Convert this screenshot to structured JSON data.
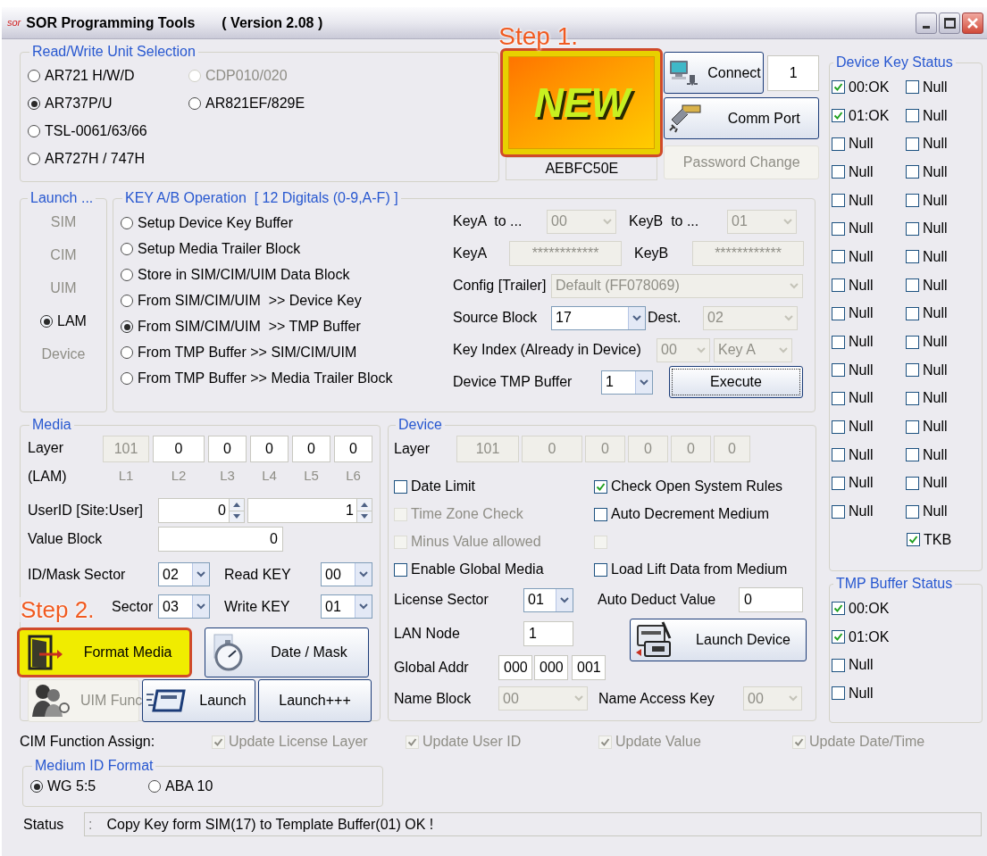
{
  "window": {
    "logo": "sor",
    "title": "SOR Programming Tools",
    "version": "( Version 2.08 )"
  },
  "unit_selection": {
    "title": "Read/Write Unit Selection",
    "rows": [
      [
        {
          "label": "AR721 H/W/D",
          "selected": false,
          "disabled": false
        },
        {
          "label": "CDP010/020",
          "selected": false,
          "disabled": true
        }
      ],
      [
        {
          "label": "AR737P/U",
          "selected": true,
          "disabled": false
        },
        {
          "label": "AR821EF/829E",
          "selected": false,
          "disabled": false
        }
      ],
      [
        {
          "label": "TSL-0061/63/66",
          "selected": false,
          "disabled": false
        }
      ],
      [
        {
          "label": "AR727H / 747H",
          "selected": false,
          "disabled": false
        }
      ]
    ]
  },
  "new_card": {
    "callout": "Step 1.",
    "label": "NEW",
    "highlighted": true,
    "serial": "AEBFC50E"
  },
  "connection": {
    "connect": {
      "label": "Connect",
      "disabled": false
    },
    "port": "1",
    "comm_port": {
      "label": "Comm Port",
      "disabled": false
    },
    "password": {
      "label": "Password Change",
      "disabled": true
    }
  },
  "launch": {
    "title": "Launch ...",
    "items": [
      {
        "label": "SIM",
        "selected": false,
        "disabled": true
      },
      {
        "label": "CIM",
        "selected": false,
        "disabled": true
      },
      {
        "label": "UIM",
        "selected": false,
        "disabled": true
      },
      {
        "label": "LAM",
        "selected": true,
        "disabled": false
      },
      {
        "label": "Device",
        "selected": false,
        "disabled": true
      }
    ]
  },
  "key_operation": {
    "title": "KEY A/B Operation  [ 12 Digitals (0-9,A-F) ]",
    "options": [
      {
        "label": "Setup Device Key Buffer",
        "selected": false
      },
      {
        "label": "Setup Media Trailer Block",
        "selected": false
      },
      {
        "label": "Store in SIM/CIM/UIM Data Block",
        "selected": false
      },
      {
        "label": "From SIM/CIM/UIM  >> Device Key",
        "selected": false
      },
      {
        "label": "From SIM/CIM/UIM  >> TMP Buffer",
        "selected": true
      },
      {
        "label": "From TMP Buffer >> SIM/CIM/UIM",
        "selected": false
      },
      {
        "label": "From TMP Buffer >> Media Trailer Block",
        "selected": false
      }
    ],
    "form": [
      [
        {
          "kind": "label",
          "text": "KeyA  to ..."
        },
        {
          "kind": "combo",
          "value": "00",
          "disabled": true
        },
        {
          "kind": "label",
          "text": "KeyB  to ..."
        },
        {
          "kind": "combo",
          "value": "01",
          "disabled": true
        }
      ],
      [
        {
          "kind": "label",
          "text": "KeyA"
        },
        {
          "kind": "field",
          "value": "************",
          "disabled": true
        },
        {
          "kind": "label",
          "text": "KeyB"
        },
        {
          "kind": "field",
          "value": "************",
          "disabled": true
        }
      ],
      [
        {
          "kind": "label",
          "text": "Config [Trailer]"
        },
        {
          "kind": "combo",
          "value": "Default (FF078069)",
          "disabled": true
        }
      ],
      [
        {
          "kind": "label",
          "text": "Source Block"
        },
        {
          "kind": "combo",
          "value": "17",
          "disabled": false
        },
        {
          "kind": "label",
          "text": "Dest."
        },
        {
          "kind": "combo",
          "value": "02",
          "disabled": true
        }
      ],
      [
        {
          "kind": "label",
          "text": "Key Index (Already in Device)"
        },
        {
          "kind": "combo",
          "value": "00",
          "disabled": true
        },
        {
          "kind": "combo",
          "value": "Key A",
          "disabled": true
        }
      ],
      [
        {
          "kind": "label",
          "text": "Device TMP Buffer"
        },
        {
          "kind": "combo",
          "value": "1",
          "disabled": false
        },
        {
          "kind": "button",
          "text": "Execute",
          "disabled": false
        }
      ]
    ]
  },
  "media": {
    "title": "Media",
    "layer_label": "Layer",
    "layer_sub": "(LAM)",
    "layers": [
      {
        "value": "101",
        "tag": "L1",
        "disabled": true
      },
      {
        "value": "0",
        "tag": "L2",
        "disabled": false
      },
      {
        "value": "0",
        "tag": "L3",
        "disabled": false
      },
      {
        "value": "0",
        "tag": "L4",
        "disabled": false
      },
      {
        "value": "0",
        "tag": "L5",
        "disabled": false
      },
      {
        "value": "0",
        "tag": "L6",
        "disabled": false
      }
    ],
    "user_id": [
      {
        "kind": "label",
        "text": "UserID [Site:User]"
      },
      {
        "kind": "spinner",
        "value": "0"
      },
      {
        "kind": "spinner",
        "value": "1"
      }
    ],
    "value_block": [
      {
        "kind": "label",
        "text": "Value Block"
      },
      {
        "kind": "field",
        "value": "0"
      }
    ],
    "sectors": [
      [
        {
          "kind": "label",
          "text": "ID/Mask Sector"
        },
        {
          "kind": "combo",
          "value": "02",
          "disabled": false
        },
        {
          "kind": "label",
          "text": "Read KEY"
        },
        {
          "kind": "combo",
          "value": "00",
          "disabled": false
        }
      ],
      [
        {
          "kind": "label",
          "text": "Sector"
        },
        {
          "kind": "combo",
          "value": "03",
          "disabled": false
        },
        {
          "kind": "label",
          "text": "Write KEY"
        },
        {
          "kind": "combo",
          "value": "01",
          "disabled": false
        }
      ]
    ],
    "buttons": [
      [
        {
          "label": "Format Media",
          "highlighted": true,
          "callout": "Step 2.",
          "disabled": false
        },
        {
          "label": "Date / Mask",
          "highlighted": false,
          "disabled": false
        }
      ],
      [
        {
          "label": "UIM Func",
          "highlighted": false,
          "disabled": true
        },
        {
          "label": "Launch",
          "highlighted": false,
          "disabled": false
        },
        {
          "label": "Launch+++",
          "highlighted": false,
          "disabled": false
        }
      ]
    ]
  },
  "device": {
    "title": "Device",
    "layer_label": "Layer",
    "layers": [
      {
        "value": "101",
        "disabled": true
      },
      {
        "value": "0",
        "disabled": true
      },
      {
        "value": "0",
        "disabled": true
      },
      {
        "value": "0",
        "disabled": true
      },
      {
        "value": "0",
        "disabled": true
      },
      {
        "value": "0",
        "disabled": true
      }
    ],
    "options": [
      {
        "label": "Date Limit",
        "checked": false,
        "disabled": false
      },
      {
        "label": "Check Open System Rules",
        "checked": true,
        "disabled": false
      },
      {
        "label": "Time Zone Check",
        "checked": false,
        "disabled": true
      },
      {
        "label": "Auto Decrement Medium",
        "checked": false,
        "disabled": false
      },
      {
        "label": "Minus Value allowed",
        "checked": false,
        "disabled": true
      },
      {
        "checked": false,
        "disabled": true
      },
      {
        "label": "Enable Global Media",
        "checked": false,
        "disabled": false
      },
      {
        "label": "Load Lift Data from Medium",
        "checked": false,
        "disabled": false
      }
    ],
    "form": [
      [
        {
          "kind": "label",
          "text": "License Sector"
        },
        {
          "kind": "combo",
          "value": "01",
          "disabled": false
        }
      ],
      [
        {
          "kind": "label",
          "text": "LAN Node"
        },
        {
          "kind": "field",
          "value": "1"
        }
      ],
      [
        {
          "kind": "label",
          "text": "Global Addr"
        },
        {
          "kind": "field",
          "value": "000"
        },
        {
          "kind": "field",
          "value": "000"
        },
        {
          "kind": "field",
          "value": "001"
        }
      ]
    ],
    "auto_deduct": [
      {
        "kind": "label",
        "text": "Auto Deduct Value"
      },
      {
        "kind": "field",
        "value": "0"
      }
    ],
    "launch_device": {
      "label": "Launch Device",
      "disabled": false
    },
    "name_row": [
      {
        "kind": "label",
        "text": "Name Block"
      },
      {
        "kind": "combo",
        "value": "00",
        "disabled": true
      },
      {
        "kind": "label",
        "text": "Name Access Key"
      },
      {
        "kind": "combo",
        "value": "00",
        "disabled": true
      }
    ]
  },
  "cim_function": {
    "label": "CIM Function Assign:",
    "options": [
      {
        "label": "Update License Layer",
        "checked": true,
        "disabled": true
      },
      {
        "label": "Update User ID",
        "checked": true,
        "disabled": true
      },
      {
        "label": "Update Value",
        "checked": true,
        "disabled": true
      },
      {
        "label": "Update Date/Time",
        "checked": true,
        "disabled": true
      }
    ]
  },
  "medium_id_format": {
    "title": "Medium ID Format",
    "options": [
      {
        "label": "WG 5:5",
        "selected": true
      },
      {
        "label": "ABA 10",
        "selected": false
      }
    ]
  },
  "status": {
    "label": "Status",
    "separator": ":",
    "message": "Copy Key form SIM(17) to Template Buffer(01) OK !"
  },
  "device_key_status": {
    "title": "Device Key Status",
    "rows": [
      [
        {
          "label": "00:OK",
          "checked": true
        },
        {
          "label": "Null",
          "checked": false
        }
      ],
      [
        {
          "label": "01:OK",
          "checked": true
        },
        {
          "label": "Null",
          "checked": false
        }
      ],
      [
        {
          "label": "Null",
          "checked": false
        },
        {
          "label": "Null",
          "checked": false
        }
      ],
      [
        {
          "label": "Null",
          "checked": false
        },
        {
          "label": "Null",
          "checked": false
        }
      ],
      [
        {
          "label": "Null",
          "checked": false
        },
        {
          "label": "Null",
          "checked": false
        }
      ],
      [
        {
          "label": "Null",
          "checked": false
        },
        {
          "label": "Null",
          "checked": false
        }
      ],
      [
        {
          "label": "Null",
          "checked": false
        },
        {
          "label": "Null",
          "checked": false
        }
      ],
      [
        {
          "label": "Null",
          "checked": false
        },
        {
          "label": "Null",
          "checked": false
        }
      ],
      [
        {
          "label": "Null",
          "checked": false
        },
        {
          "label": "Null",
          "checked": false
        }
      ],
      [
        {
          "label": "Null",
          "checked": false
        },
        {
          "label": "Null",
          "checked": false
        }
      ],
      [
        {
          "label": "Null",
          "checked": false
        },
        {
          "label": "Null",
          "checked": false
        }
      ],
      [
        {
          "label": "Null",
          "checked": false
        },
        {
          "label": "Null",
          "checked": false
        }
      ],
      [
        {
          "label": "Null",
          "checked": false
        },
        {
          "label": "Null",
          "checked": false
        }
      ],
      [
        {
          "label": "Null",
          "checked": false
        },
        {
          "label": "Null",
          "checked": false
        }
      ],
      [
        {
          "label": "Null",
          "checked": false
        },
        {
          "label": "Null",
          "checked": false
        }
      ],
      [
        {
          "label": "Null",
          "checked": false
        },
        {
          "label": "Null",
          "checked": false
        }
      ]
    ],
    "extra": {
      "label": "TKB",
      "checked": true
    }
  },
  "tmp_buffer_status": {
    "title": "TMP Buffer Status",
    "items": [
      {
        "label": "00:OK",
        "checked": true
      },
      {
        "label": "01:OK",
        "checked": true
      },
      {
        "label": "Null",
        "checked": false
      },
      {
        "label": "Null",
        "checked": false
      }
    ]
  }
}
